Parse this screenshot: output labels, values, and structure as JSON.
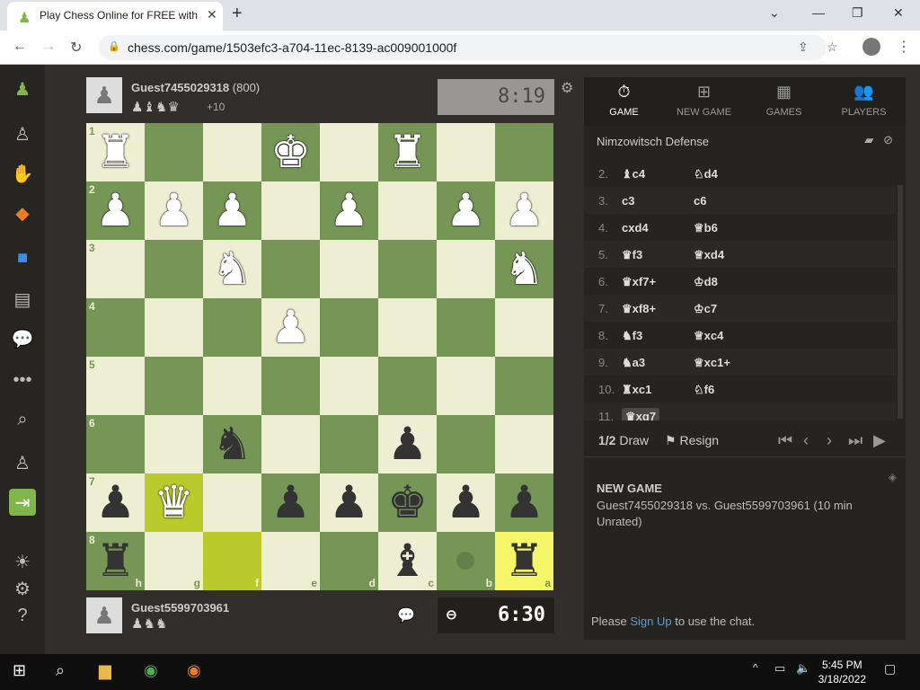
{
  "browser": {
    "tab_title": "Play Chess Online for FREE with F",
    "url": "chess.com/game/1503efc3-a704-11ec-8139-ac009001000f"
  },
  "top_player": {
    "name": "Guest7455029318",
    "rating": "(800)",
    "captured": "♟♝♞♛",
    "material": "+10",
    "clock": "8:19"
  },
  "bottom_player": {
    "name": "Guest5599703961",
    "captured": "♟♞♞",
    "clock": "6:30"
  },
  "board": {
    "ranks": [
      "1",
      "2",
      "3",
      "4",
      "5",
      "6",
      "7",
      "8"
    ],
    "files": [
      "h",
      "g",
      "f",
      "e",
      "d",
      "c",
      "b",
      "a"
    ],
    "pieces": [
      {
        "sq": "h1",
        "p": "♜",
        "c": "w"
      },
      {
        "sq": "e1",
        "p": "♚",
        "c": "w"
      },
      {
        "sq": "c1",
        "p": "♜",
        "c": "w"
      },
      {
        "sq": "h2",
        "p": "♟",
        "c": "w"
      },
      {
        "sq": "g2",
        "p": "♟",
        "c": "w"
      },
      {
        "sq": "f2",
        "p": "♟",
        "c": "w"
      },
      {
        "sq": "d2",
        "p": "♟",
        "c": "w"
      },
      {
        "sq": "b2",
        "p": "♟",
        "c": "w"
      },
      {
        "sq": "a2",
        "p": "♟",
        "c": "w"
      },
      {
        "sq": "f3",
        "p": "♞",
        "c": "w"
      },
      {
        "sq": "a3",
        "p": "♞",
        "c": "w"
      },
      {
        "sq": "e4",
        "p": "♟",
        "c": "w"
      },
      {
        "sq": "f6",
        "p": "♞",
        "c": "b"
      },
      {
        "sq": "c6",
        "p": "♟",
        "c": "b"
      },
      {
        "sq": "h7",
        "p": "♟",
        "c": "b"
      },
      {
        "sq": "g7",
        "p": "♛",
        "c": "w"
      },
      {
        "sq": "e7",
        "p": "♟",
        "c": "b"
      },
      {
        "sq": "d7",
        "p": "♟",
        "c": "b"
      },
      {
        "sq": "c7",
        "p": "♚",
        "c": "b"
      },
      {
        "sq": "b7",
        "p": "♟",
        "c": "b"
      },
      {
        "sq": "a7",
        "p": "♟",
        "c": "b"
      },
      {
        "sq": "h8",
        "p": "♜",
        "c": "b"
      },
      {
        "sq": "c8",
        "p": "♝",
        "c": "b"
      },
      {
        "sq": "a8",
        "p": "♜",
        "c": "b"
      }
    ],
    "highlights": [
      "g7",
      "f8"
    ],
    "dot": "b8",
    "highlight_corner": "a8"
  },
  "panel": {
    "tabs": [
      {
        "icon": "⏱",
        "label": "GAME"
      },
      {
        "icon": "⊞",
        "label": "NEW GAME"
      },
      {
        "icon": "▦",
        "label": "GAMES"
      },
      {
        "icon": "👥",
        "label": "PLAYERS"
      }
    ],
    "opening": "Nimzowitsch Defense",
    "moves": [
      {
        "n": "2.",
        "w": "♝c4",
        "b": "♘d4"
      },
      {
        "n": "3.",
        "w": "c3",
        "b": "c6"
      },
      {
        "n": "4.",
        "w": "cxd4",
        "b": "♕b6"
      },
      {
        "n": "5.",
        "w": "♛f3",
        "b": "♕xd4"
      },
      {
        "n": "6.",
        "w": "♛xf7+",
        "b": "♔d8"
      },
      {
        "n": "7.",
        "w": "♛xf8+",
        "b": "♔c7"
      },
      {
        "n": "8.",
        "w": "♞f3",
        "b": "♕xc4"
      },
      {
        "n": "9.",
        "w": "♞a3",
        "b": "♕xc1+"
      },
      {
        "n": "10.",
        "w": "♜xc1",
        "b": "♘f6"
      },
      {
        "n": "11.",
        "w": "♛xg7",
        "b": ""
      }
    ],
    "draw_label": "Draw",
    "draw_icon": "1/2",
    "resign_label": "Resign",
    "chat_title": "NEW GAME",
    "chat_line": "Guest7455029318 vs. Guest5599703961 (10 min Unrated)",
    "chat_prefix": "Please",
    "chat_link": "Sign Up",
    "chat_suffix": "to use the chat."
  },
  "taskbar": {
    "time": "5:45 PM",
    "date": "3/18/2022"
  }
}
